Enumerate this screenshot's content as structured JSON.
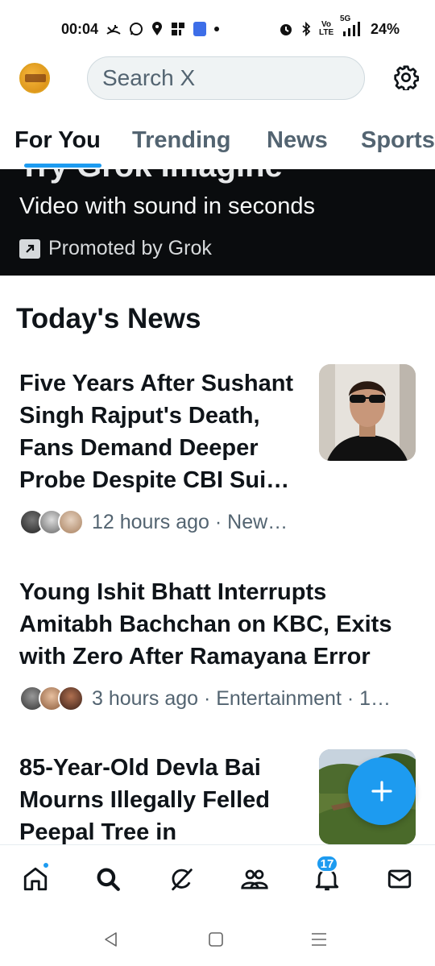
{
  "status_bar": {
    "time": "00:04",
    "network": "5G",
    "signal_small": "Vo LTE",
    "battery": "24%"
  },
  "header": {
    "search_placeholder": "Search X"
  },
  "tabs": [
    {
      "label": "For You",
      "active": true
    },
    {
      "label": "Trending",
      "active": false
    },
    {
      "label": "News",
      "active": false
    },
    {
      "label": "Sports",
      "active": false
    }
  ],
  "promo": {
    "title": "Try Grok Imagine",
    "subtitle": "Video with sound in seconds",
    "tag": "Promoted by Grok"
  },
  "section": {
    "title": "Today's News"
  },
  "stories": [
    {
      "title": "Five Years After Sushant Singh Rajput's Death, Fans Demand Deeper Probe Despite CBI Sui…",
      "meta": "12 hours ago · New…"
    },
    {
      "title": "Young Ishit Bhatt Interrupts Amitabh Bachchan on KBC, Exits with Zero After Ramayana Error",
      "meta": "3 hours ago · Entertainment · 1…"
    },
    {
      "title": "85-Year-Old Devla Bai Mourns Illegally Felled Peepal Tree in",
      "meta": ""
    }
  ],
  "bottom_nav": {
    "notifications_count": "17",
    "items": [
      "home-icon",
      "search-icon",
      "grok-icon",
      "communities-icon",
      "notifications-icon",
      "messages-icon"
    ]
  },
  "colors": {
    "accent": "#1d9bf0",
    "text": "#0f1419",
    "secondary": "#536471",
    "promo_bg": "#0a0c0e"
  }
}
